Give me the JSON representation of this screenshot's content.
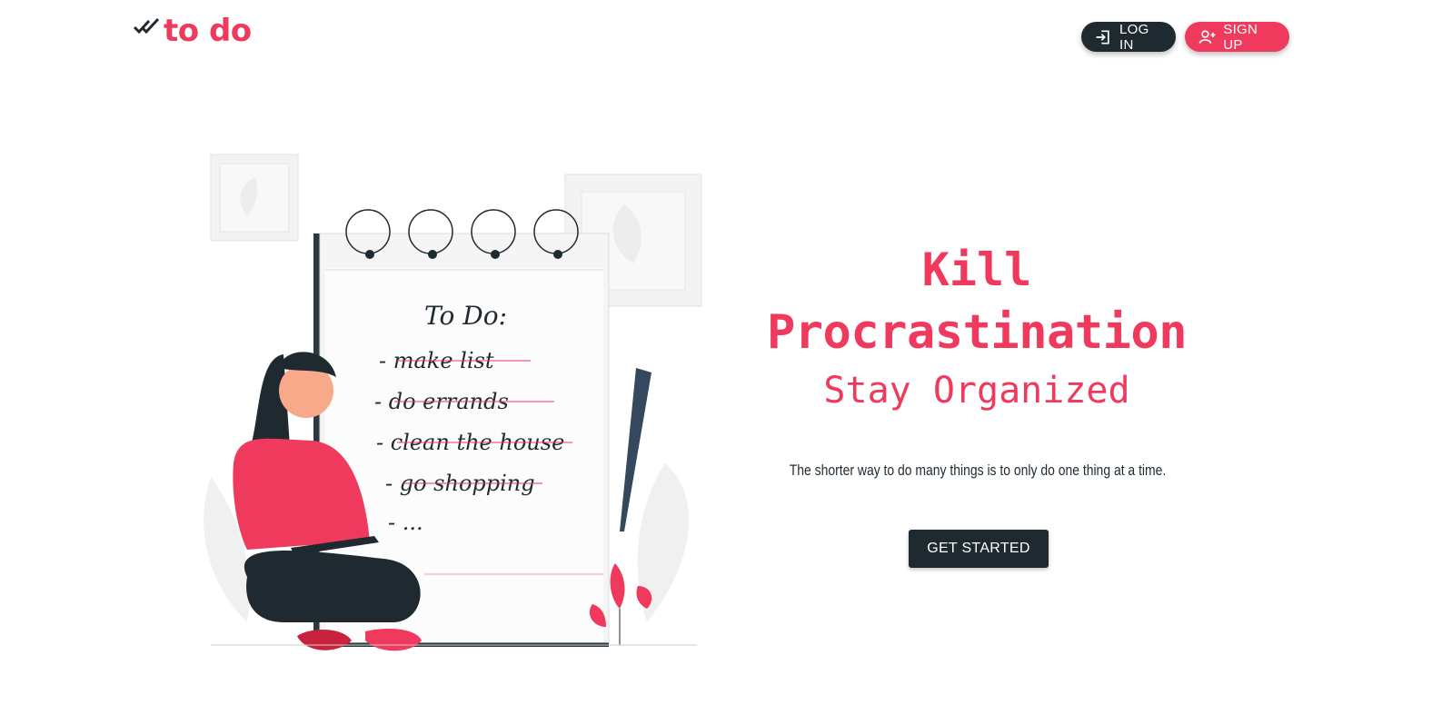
{
  "brand": {
    "logo_text": "to do",
    "accent_color": "#ef3a5d",
    "dark_color": "#1f2a30"
  },
  "nav": {
    "login_label": "LOG IN",
    "signup_label": "SIGN UP",
    "login_icon": "login-icon",
    "signup_icon": "add-user-icon"
  },
  "hero": {
    "line1": "Kill",
    "line2": "Procrastination",
    "line3": "Stay Organized",
    "quote": "The shorter way to do many things is to only do one thing at a time.",
    "cta_label": "GET STARTED"
  },
  "illustration": {
    "note_title": "To Do:",
    "items": [
      "- make list",
      "- do errands",
      "- clean the house",
      "- go shopping",
      "- ..."
    ]
  }
}
